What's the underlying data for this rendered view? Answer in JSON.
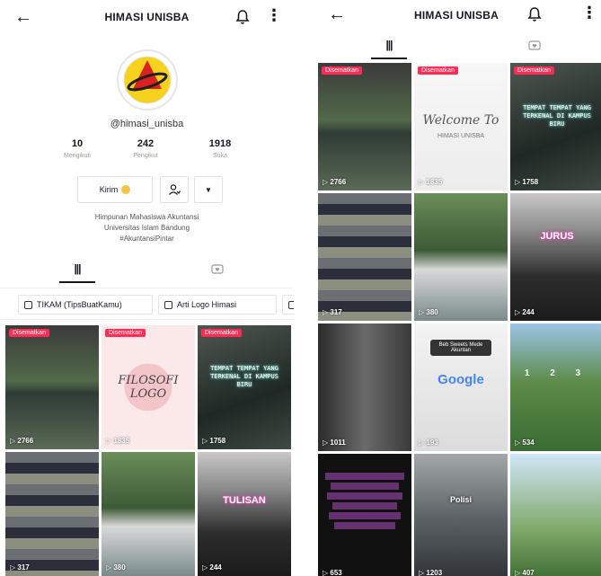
{
  "left": {
    "header": {
      "title": "HIMASI UNISBA"
    },
    "profile": {
      "username": "@himasi_unisba",
      "stats": [
        {
          "value": "10",
          "label": "Mengikuti"
        },
        {
          "value": "242",
          "label": "Pengikut"
        },
        {
          "value": "1918",
          "label": "Suka"
        }
      ],
      "message_button": "Kirim",
      "dropdown_glyph": "▼",
      "bio": [
        "Himpunan Mahasiswa Akuntansi",
        "Universitas Islam Bandung",
        "#AkuntansiPintar"
      ]
    },
    "tabs": {
      "videos_icon": "grid-icon",
      "liked_icon": "liked-icon"
    },
    "playlists": [
      "TIKAM (TipsBuatKamu)",
      "Arti Logo Himasi",
      ""
    ],
    "videos": [
      {
        "pinned": "Disematkan",
        "views": "2766"
      },
      {
        "pinned": "Disematkan",
        "views": "1835",
        "caption": "FILOSOFI LOGO"
      },
      {
        "pinned": "Disematkan",
        "views": "1758",
        "caption": "TEMPAT TEMPAT YANG TERKENAL DI KAMPUS BIRU"
      },
      {
        "views": "317"
      },
      {
        "views": "380"
      },
      {
        "views": "244",
        "caption": "TULISAN"
      }
    ]
  },
  "right": {
    "header": {
      "title": "HIMASI UNISBA"
    },
    "tabs": {
      "videos_icon": "grid-icon",
      "liked_icon": "liked-icon"
    },
    "videos": [
      {
        "pinned": "Disematkan",
        "views": "2766"
      },
      {
        "pinned": "Disematkan",
        "views": "1835",
        "caption": "Welcome To",
        "subcaption": "HIMASI UNISBA"
      },
      {
        "pinned": "Disematkan",
        "views": "1758",
        "caption": "TEMPAT TEMPAT YANG TERKENAL DI KAMPUS BIRU"
      },
      {
        "views": "317"
      },
      {
        "views": "380"
      },
      {
        "views": "244",
        "caption": "JURUS"
      },
      {
        "views": "1011"
      },
      {
        "views": "193",
        "caption": "Google",
        "subcaption": "Beb Sweets Mede Akuntan"
      },
      {
        "views": "534",
        "caption": "1 2 3"
      },
      {
        "views": "653"
      },
      {
        "views": "1203",
        "caption": "Polisi"
      },
      {
        "views": "407"
      }
    ]
  },
  "colors": {
    "pin": "#fe2c55",
    "text": "#161823",
    "muted": "#9a9a9a"
  }
}
